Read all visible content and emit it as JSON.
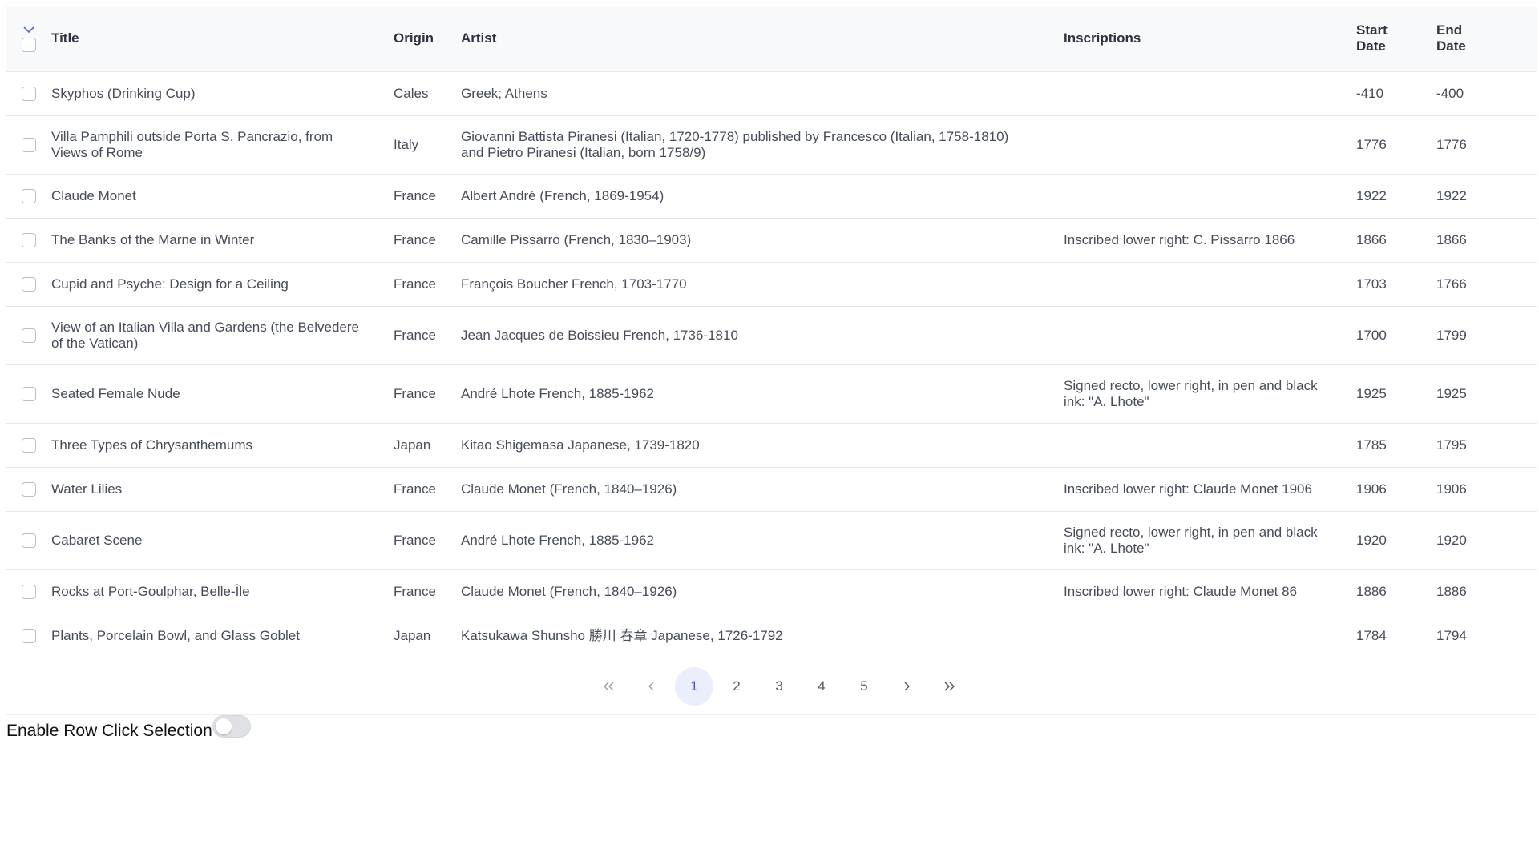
{
  "columns": {
    "sort_icon": "chevron-down-icon",
    "title": "Title",
    "origin": "Origin",
    "artist": "Artist",
    "inscriptions": "Inscriptions",
    "start_date": "Start Date",
    "end_date": "End Date"
  },
  "rows": [
    {
      "title": "Skyphos (Drinking Cup)",
      "origin": "Cales",
      "artist": "Greek; Athens",
      "inscriptions": "",
      "start": "-410",
      "end": "-400"
    },
    {
      "title": "Villa Pamphili outside Porta S. Pancrazio, from Views of Rome",
      "origin": "Italy",
      "artist": "Giovanni Battista Piranesi (Italian, 1720-1778) published by Francesco (Italian, 1758-1810) and Pietro Piranesi (Italian, born 1758/9)",
      "inscriptions": "",
      "start": "1776",
      "end": "1776"
    },
    {
      "title": "Claude Monet",
      "origin": "France",
      "artist": "Albert André (French, 1869-1954)",
      "inscriptions": "",
      "start": "1922",
      "end": "1922"
    },
    {
      "title": "The Banks of the Marne in Winter",
      "origin": "France",
      "artist": "Camille Pissarro (French, 1830–1903)",
      "inscriptions": "Inscribed lower right: C. Pissarro 1866",
      "start": "1866",
      "end": "1866"
    },
    {
      "title": "Cupid and Psyche: Design for a Ceiling",
      "origin": "France",
      "artist": "François Boucher French, 1703-1770",
      "inscriptions": "",
      "start": "1703",
      "end": "1766"
    },
    {
      "title": "View of an Italian Villa and Gardens (the Belvedere of the Vatican)",
      "origin": "France",
      "artist": "Jean Jacques de Boissieu French, 1736-1810",
      "inscriptions": "",
      "start": "1700",
      "end": "1799"
    },
    {
      "title": "Seated Female Nude",
      "origin": "France",
      "artist": "André Lhote French, 1885-1962",
      "inscriptions": "Signed recto, lower right, in pen and black ink: \"A. Lhote\"",
      "start": "1925",
      "end": "1925"
    },
    {
      "title": "Three Types of Chrysanthemums",
      "origin": "Japan",
      "artist": "Kitao Shigemasa Japanese, 1739-1820",
      "inscriptions": "",
      "start": "1785",
      "end": "1795"
    },
    {
      "title": "Water Lilies",
      "origin": "France",
      "artist": "Claude Monet (French, 1840–1926)",
      "inscriptions": "Inscribed lower right: Claude Monet 1906",
      "start": "1906",
      "end": "1906"
    },
    {
      "title": "Cabaret Scene",
      "origin": "France",
      "artist": "André Lhote French, 1885-1962",
      "inscriptions": "Signed recto, lower right, in pen and black ink: \"A. Lhote\"",
      "start": "1920",
      "end": "1920"
    },
    {
      "title": "Rocks at Port-Goulphar, Belle-Île",
      "origin": "France",
      "artist": "Claude Monet (French, 1840–1926)",
      "inscriptions": "Inscribed lower right: Claude Monet 86",
      "start": "1886",
      "end": "1886"
    },
    {
      "title": "Plants, Porcelain Bowl, and Glass Goblet",
      "origin": "Japan",
      "artist": "Katsukawa Shunsho 勝川 春章 Japanese, 1726-1792",
      "inscriptions": "",
      "start": "1784",
      "end": "1794"
    }
  ],
  "pagination": {
    "first": "«",
    "prev": "‹",
    "pages": [
      "1",
      "2",
      "3",
      "4",
      "5"
    ],
    "current": "1",
    "next": "›",
    "last": "»"
  },
  "toggle": {
    "label": "Enable Row Click Selection",
    "enabled": false
  }
}
